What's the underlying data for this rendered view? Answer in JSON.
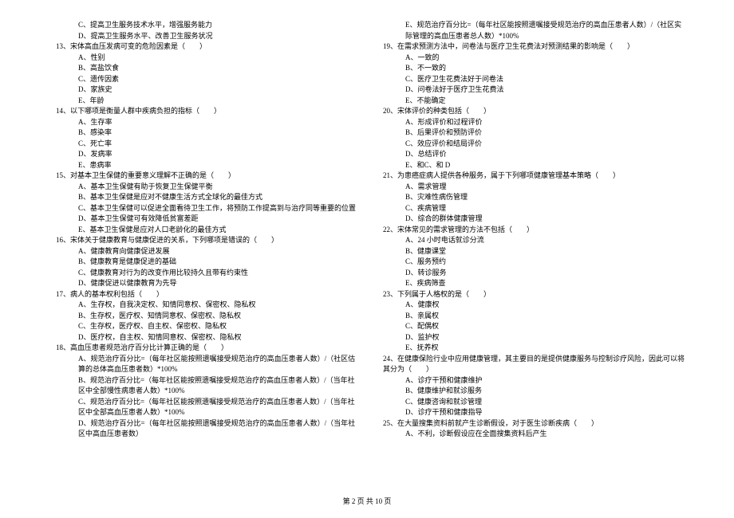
{
  "left": {
    "l0": "C、提高卫生服务技术水平，增强服务能力",
    "l1": "D、提高卫生服务水平、改善卫生服务状况",
    "q13": "13、宋体高血压发病可变的危险因素是（　　）",
    "q13a": "A、性别",
    "q13b": "B、高盐饮食",
    "q13c": "C、遗传因素",
    "q13d": "D、家族史",
    "q13e": "E、年龄",
    "q14": "14、以下哪项是衡量人群中疾病负担的指标（　　）",
    "q14a": "A、生存率",
    "q14b": "B、感染率",
    "q14c": "C、死亡率",
    "q14d": "D、发病率",
    "q14e": "E、患病率",
    "q15": "15、对基本卫生保健的重要意义理解不正确的是（　　）",
    "q15a": "A、基本卫生保健有助于恢复卫生保健平衡",
    "q15b": "B、基本卫生保健是应对不健康生活方式全球化的最佳方式",
    "q15c": "C、基本卫生保健可以促进全面看待卫生工作，将预防工作提高到与治疗同等重要的位置",
    "q15d": "D、基本卫生保健可有效降低贫富差距",
    "q15e": "E、基本卫生保健是应对人口老龄化的最佳方式",
    "q16": "16、宋体关于健康教育与健康促进的关系，下列哪项是错误的（　　）",
    "q16a": "A、健康教育向健康促进发展",
    "q16b": "B、健康教育是健康促进的基础",
    "q16c": "C、健康教育对行为的改变作用比较持久且带有约束性",
    "q16d": "D、健康促进以健康教育为先导",
    "q17": "17、病人的基本权利包括（　　）",
    "q17a": "A、生存权，自我决定权、知情同意权、保密权、隐私权",
    "q17b": "B、生存权，医疗权、知情同意权、保密权、隐私权",
    "q17c": "C、生存权，医疗权、自主权、保密权、隐私权",
    "q17d": "D、医疗权，自主权、知情同意权、保密权、隐私权",
    "q18": "18、高血压患者规范治疗百分比计算正确的是（　　）",
    "q18a": "A、规范治疗百分比=（每年社区能按照遗嘱接受规范治疗的高血压患者人数）/（社区估算的总体高血压患者数）*100%",
    "q18b": "B、规范治疗百分比=（每年社区能按照遗嘱接受规范治疗的高血压患者人数）/（当年社区中全部慢性病患者人数）*100%",
    "q18c": "C、规范治疗百分比=（每年社区能按照遗嘱接受规范治疗的高血压患者人数）/（当年社区中全部高血压患者人数）*100%",
    "q18d": "D、规范治疗百分比=（每年社区能按照遗嘱接受规范治疗的高血压患者人数）/（当年社区中高血压患者数）"
  },
  "right": {
    "r0": "E、规范治疗百分比=（每年社区能按照遗嘱接受规范治疗的高血压患者人数）/（社区实际管理的高血压患者总人数）*100%",
    "q19": "19、在需求预测方法中，问卷法与医疗卫生花费法对预测结果的影响是（　　）",
    "q19a": "A、一致的",
    "q19b": "B、不一致的",
    "q19c": "C、医疗卫生花费法好于问卷法",
    "q19d": "D、问卷法好于医疗卫生花费法",
    "q19e": "E、不能确定",
    "q20": "20、宋体评价的种类包括（　　）",
    "q20a": "A、形成评价和过程评价",
    "q20b": "B、后果评价和预防评价",
    "q20c": "C、效应评价和结局评价",
    "q20d": "D、总结评价",
    "q20e": "E、和C、和 D",
    "q21": "21、为患癌症病人提供各种服务，属于下列哪项健康管理基本策略（　　）",
    "q21a": "A、需求管理",
    "q21b": "B、灾难性病伤管理",
    "q21c": "C、疾病管理",
    "q21d": "D、综合的群体健康管理",
    "q22": "22、宋体常见的需求管理的方法不包括（　　）",
    "q22a": "A、24 小时电话就诊分流",
    "q22b": "B、健康课堂",
    "q22c": "C、服务预约",
    "q22d": "D、转诊服务",
    "q22e": "E、疾病筛查",
    "q23": "23、下列属于人格权的是（　　）",
    "q23a": "A、健康权",
    "q23b": "B、亲属权",
    "q23c": "C、配偶权",
    "q23d": "D、监护权",
    "q23e": "E、抚养权",
    "q24": "24、在健康保险行业中应用健康管理，其主要目的是提供健康服务与控制诊疗风险，因此可以将其分为（　　）",
    "q24a": "A、诊疗干预和健康维护",
    "q24b": "B、健康维护和就诊服务",
    "q24c": "C、健康咨询和就诊管理",
    "q24d": "D、诊疗干预和健康指导",
    "q25": "25、在大量搜集资料前就产生诊断假设，对于医生诊断疾病（　　）",
    "q25a": "A、不利，诊断假设应在全面搜集资料后产生"
  },
  "footer": "第 2 页 共 10 页"
}
